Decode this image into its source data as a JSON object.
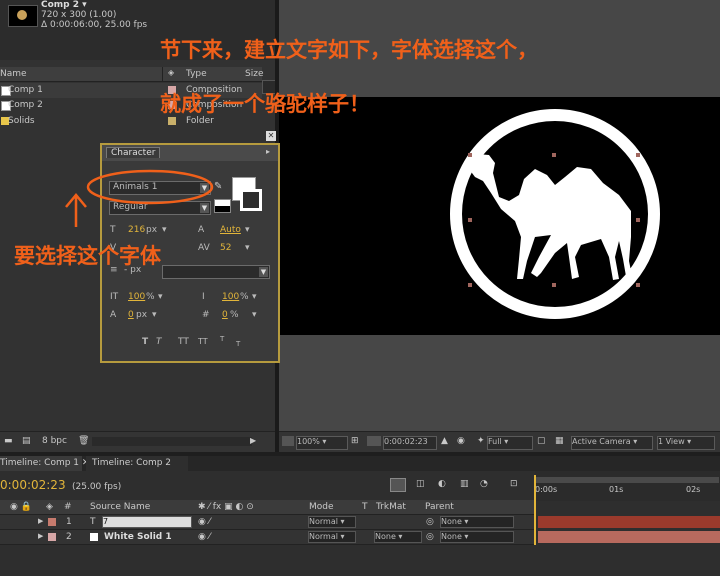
{
  "project": {
    "comp_name": "Comp 2 ▾",
    "comp_size": "720 x 300 (1.00)",
    "comp_duration": "Δ 0:00:06:00, 25.00 fps",
    "columns": {
      "name": "Name",
      "type": "Type",
      "size": "Size"
    },
    "items": [
      {
        "name": "Comp 1",
        "type": "Composition",
        "color": "#d7a7a7"
      },
      {
        "name": "Comp 2",
        "type": "Composition",
        "color": "#d7a7a7"
      },
      {
        "name": "Solids",
        "type": "Folder",
        "color": "#c9b06a"
      }
    ],
    "bpc": "8 bpc"
  },
  "character": {
    "title": "Character",
    "font_family": "Animals 1",
    "font_style": "Regular",
    "font_size": "216",
    "font_size_unit": "px",
    "leading": "Auto",
    "kerning": "",
    "tracking": "52",
    "stroke_width": "- px",
    "vertical_scale": "100",
    "horizontal_scale": "100",
    "scale_unit": "%",
    "baseline_shift": "0",
    "baseline_unit": "px",
    "tsume": "0",
    "tsume_unit": "%",
    "format_buttons": [
      "T",
      "T",
      "TT",
      "TT",
      "T",
      "T"
    ]
  },
  "viewer": {
    "zoom": "100%",
    "timecode": "0:00:02:23",
    "resolution": "Full",
    "camera": "Active Camera",
    "views": "1 View"
  },
  "timeline": {
    "tabs": [
      "Timeline: Comp 1",
      "Timeline: Comp 2"
    ],
    "current_time": "0:00:02:23",
    "fps": "(25.00 fps)",
    "columns": {
      "num": "#",
      "source": "Source Name",
      "mode": "Mode",
      "t": "T",
      "trkmat": "TrkMat",
      "parent": "Parent"
    },
    "ruler": [
      "0:00s",
      "01s",
      "02s"
    ],
    "layers": [
      {
        "num": "1",
        "source": "7",
        "mode": "Normal",
        "trkmat": "",
        "parent": "None",
        "color": "#c77b6e",
        "bar_color": "#9b3a2c"
      },
      {
        "num": "2",
        "source": "White Solid 1",
        "mode": "Normal",
        "trkmat": "None",
        "parent": "None",
        "color": "#d7a7a7",
        "bar_color": "#b86a5e"
      }
    ]
  },
  "annotations": {
    "top_line1": "节下来，建立文字如下，字体选择这个，",
    "top_line2": "就成了一个骆驼样子！",
    "select_font": "要选择这个字体"
  }
}
